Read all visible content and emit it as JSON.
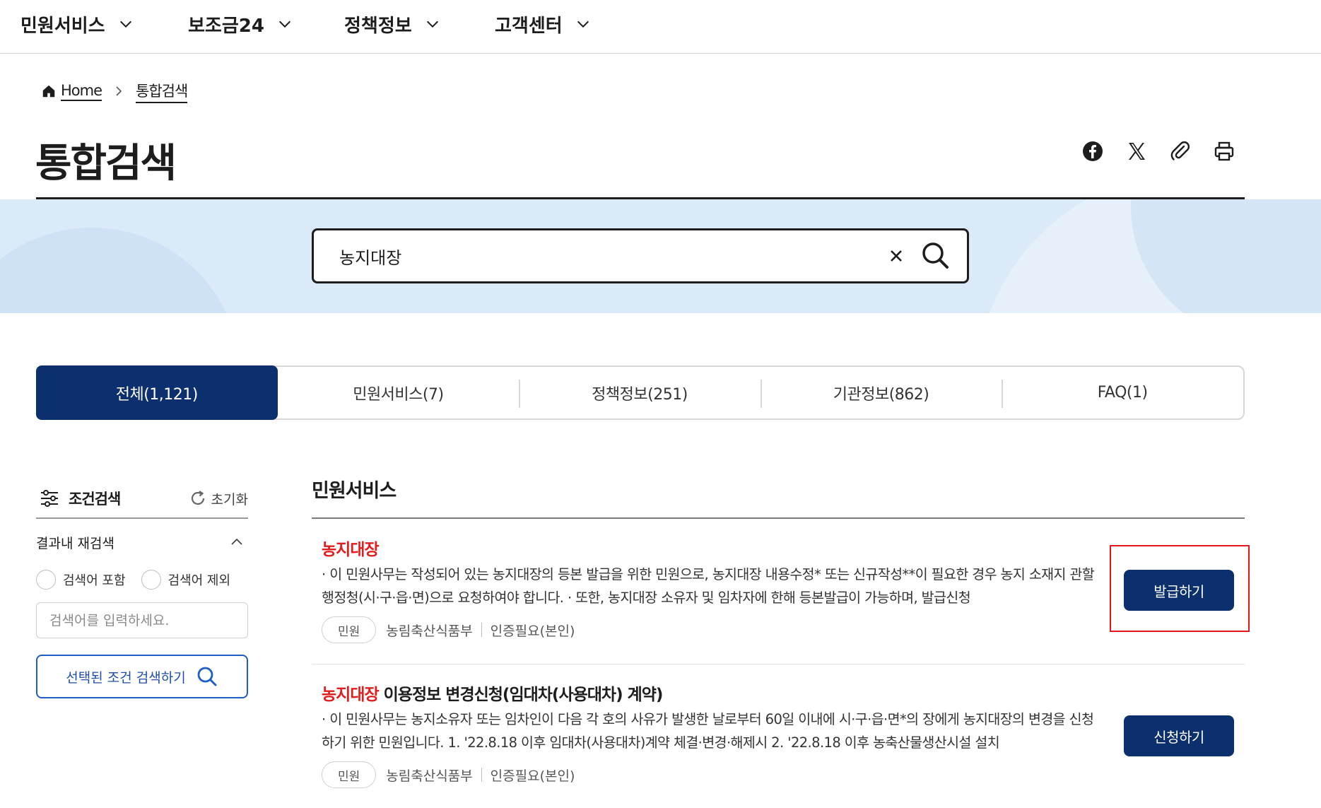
{
  "nav": {
    "items": [
      {
        "label": "민원서비스"
      },
      {
        "label": "보조금24"
      },
      {
        "label": "정책정보"
      },
      {
        "label": "고객센터"
      }
    ]
  },
  "breadcrumb": {
    "home": "Home",
    "current": "통합검색"
  },
  "page": {
    "title": "통합검색"
  },
  "share_icons": [
    "facebook-icon",
    "x-icon",
    "paperclip-icon",
    "printer-icon"
  ],
  "search": {
    "value": "농지대장"
  },
  "tabs": [
    {
      "label": "전체(1,121)",
      "active": true
    },
    {
      "label": "민원서비스(7)",
      "active": false
    },
    {
      "label": "정책정보(251)",
      "active": false
    },
    {
      "label": "기관정보(862)",
      "active": false
    },
    {
      "label": "FAQ(1)",
      "active": false
    }
  ],
  "sidebar": {
    "title": "조건검색",
    "reset": "초기화",
    "refine_title": "결과내 재검색",
    "include_label": "검색어 포함",
    "exclude_label": "검색어 제외",
    "input_placeholder": "검색어를 입력하세요.",
    "submit_label": "선택된 조건 검색하기"
  },
  "results": {
    "section_title": "민원서비스",
    "items": [
      {
        "title_highlight": "농지대장",
        "title_rest": "",
        "description": "· 이 민원사무는 작성되어 있는 농지대장의 등본 발급을 위한 민원으로, 농지대장 내용수정* 또는 신규작성**이 필요한 경우 농지 소재지 관할 행정청(시·구·읍·면)으로 요청하여야 합니다. · 또한, 농지대장 소유자 및 임차자에 한해 등본발급이 가능하며, 발급신청",
        "tag": "민원",
        "agency": "농림축산식품부",
        "auth": "인증필요(본인)",
        "action": "발급하기"
      },
      {
        "title_highlight": "농지대장",
        "title_rest": " 이용정보 변경신청(임대차(사용대차) 계약)",
        "description": "· 이 민원사무는 농지소유자 또는 임차인이 다음 각 호의 사유가 발생한 날로부터 60일 이내에 시·구·읍·면*의 장에게 농지대장의 변경을 신청하기 위한 민원입니다. 1. '22.8.18 이후 임대차(사용대차)계약 체결·변경·해제시 2. '22.8.18 이후 농축산물생산시설 설치",
        "tag": "민원",
        "agency": "농림축산식품부",
        "auth": "인증필요(본인)",
        "action": "신청하기"
      }
    ]
  },
  "colors": {
    "primary": "#0c2f6e",
    "highlight": "#e11d1d",
    "annotation": "#e8141c",
    "banner": "#dbeaf8"
  }
}
